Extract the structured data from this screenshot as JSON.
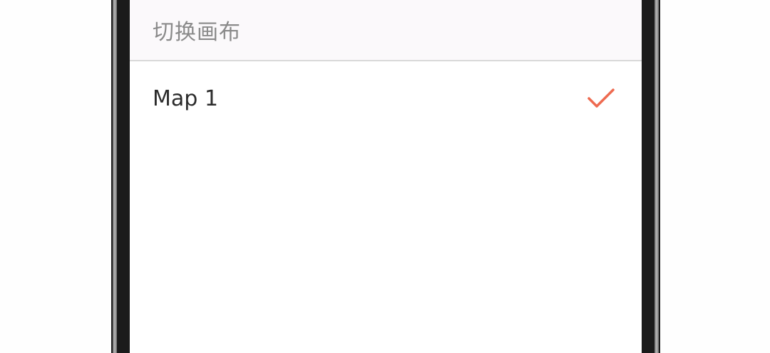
{
  "dialog": {
    "title": "切换画布",
    "items": [
      {
        "label": "Map 1",
        "selected": true,
        "indicator_icon": "checkmark-icon"
      }
    ]
  },
  "colors": {
    "accent": "#ee6a50",
    "header_background": "#fbf9fb",
    "title_text": "#8a8a8a",
    "item_text": "#2c2c2c"
  }
}
